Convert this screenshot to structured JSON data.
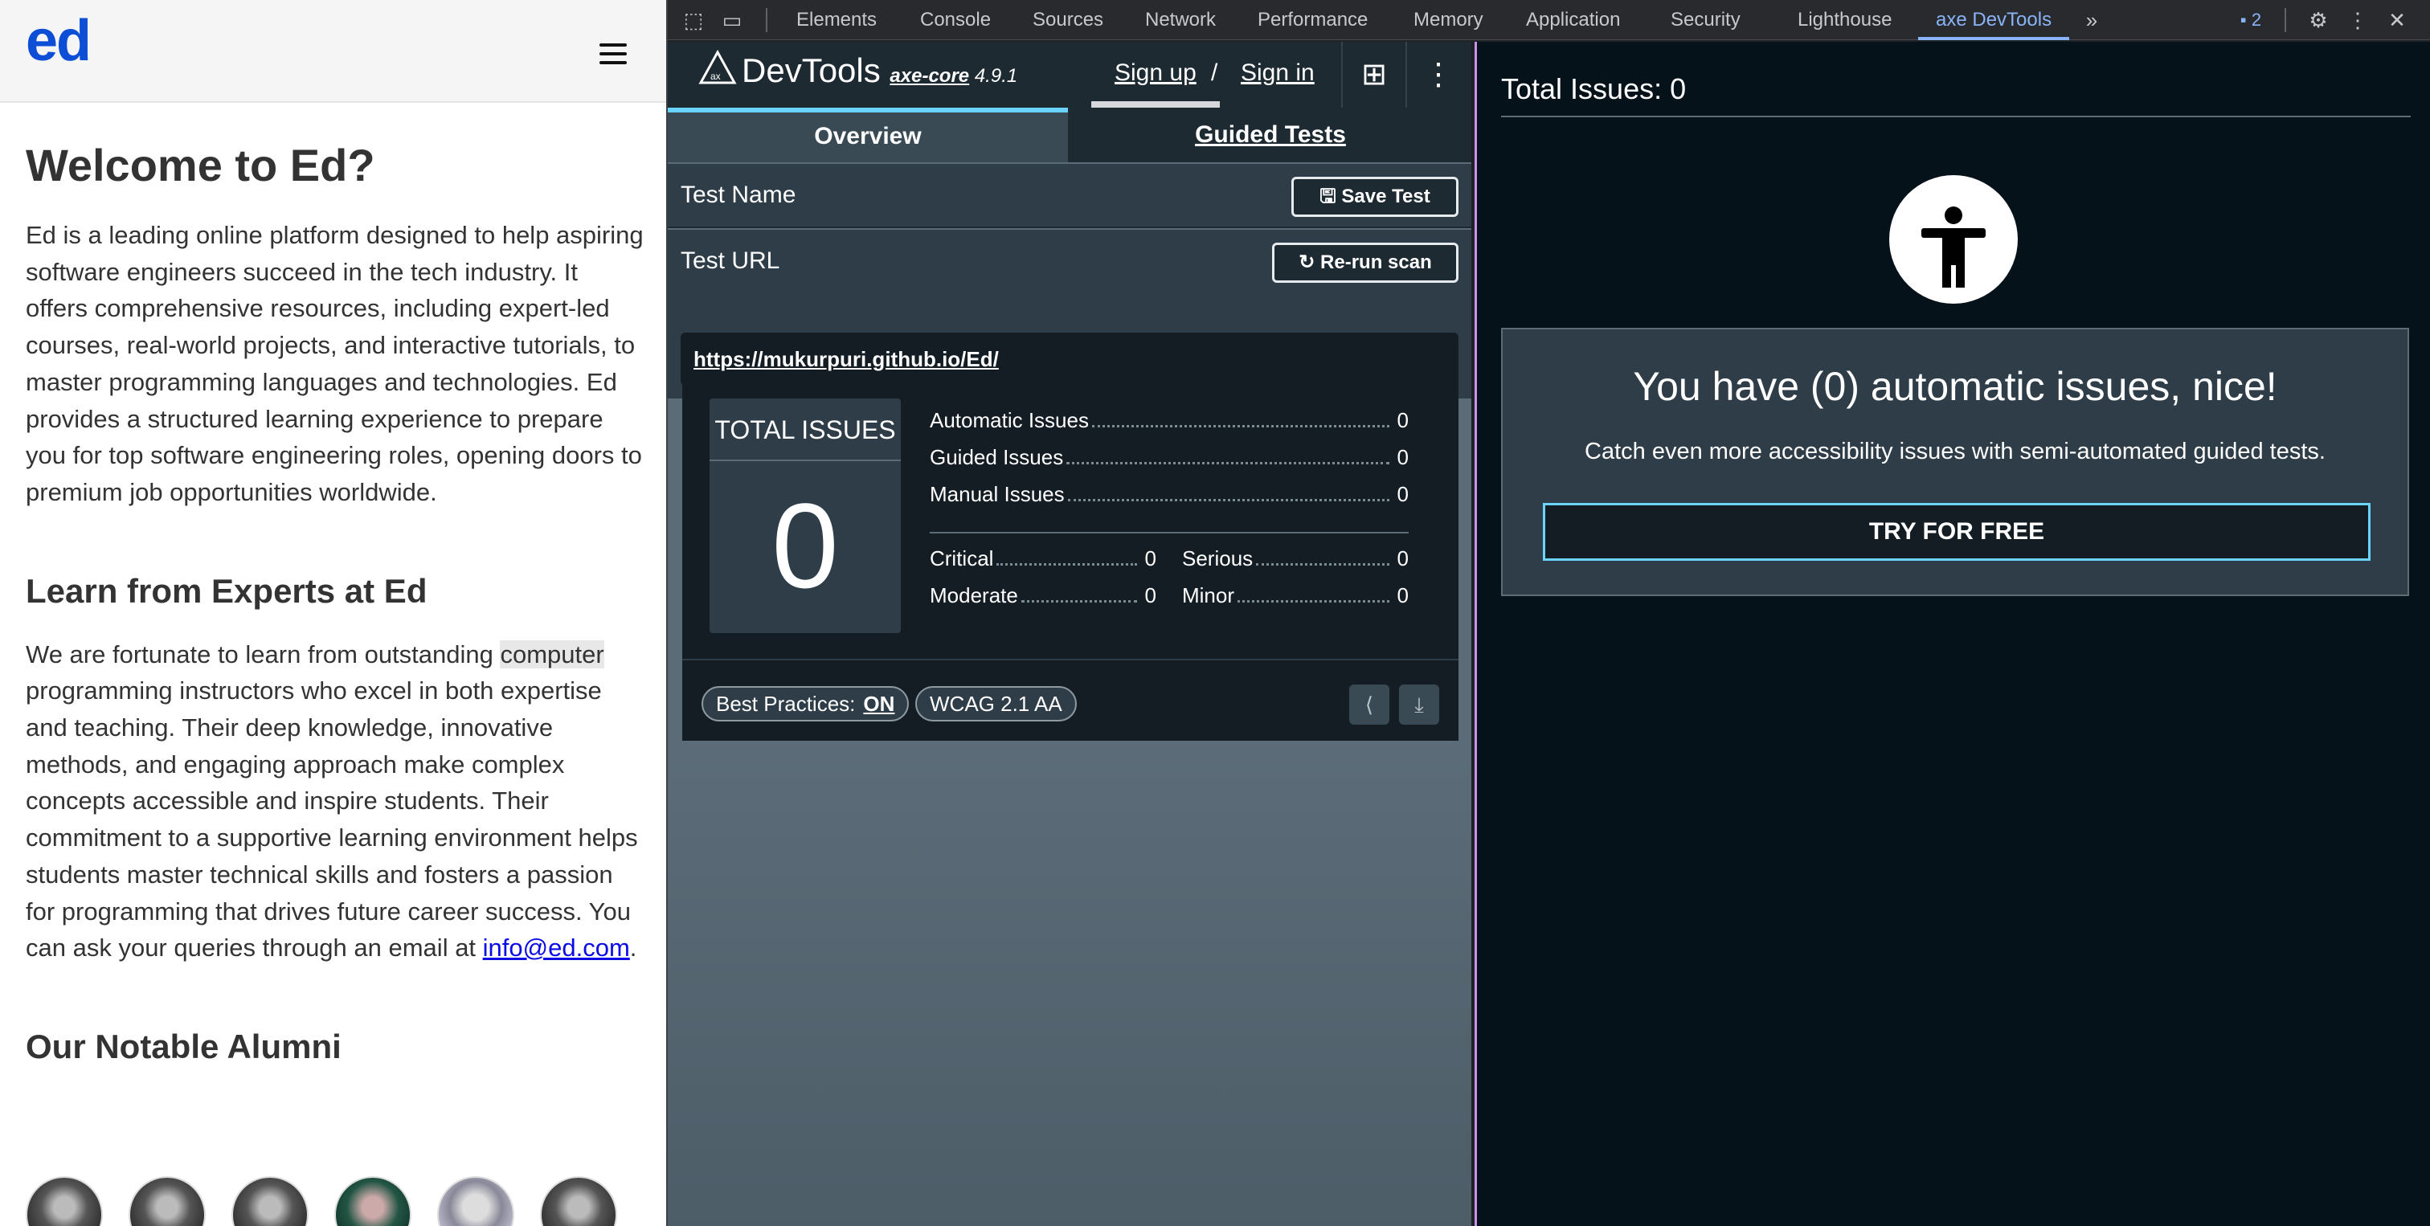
{
  "page": {
    "logo": "ed",
    "heading": "Welcome to Ed?",
    "intro": "Ed is a leading online platform designed to help aspiring software engineers succeed in the tech industry. It offers comprehensive resources, including expert-led courses, real-world projects, and interactive tutorials, to master programming languages and technologies. Ed provides a structured learning experience to prepare you for top software engineering roles, opening doors to premium job opportunities worldwide.",
    "experts_heading": "Learn from Experts at Ed",
    "experts_text_before": "We are fortunate to learn from outstanding ",
    "experts_highlight": "computer",
    "experts_text_after": " programming instructors who excel in both expertise and teaching. Their deep knowledge, innovative methods, and engaging approach make complex concepts accessible and inspire students. Their commitment to a supportive learning environment helps students master technical skills and fosters a passion for programming that drives future career success. You can ask your queries through an email at ",
    "email": "info@ed.com",
    "email_suffix": ".",
    "alumni_heading": "Our Notable Alumni"
  },
  "devtools": {
    "tabs": [
      "Elements",
      "Console",
      "Sources",
      "Network",
      "Performance",
      "Memory",
      "Application",
      "Security",
      "Lighthouse",
      "axe DevTools"
    ],
    "active_tab": "axe DevTools",
    "issues_badge": "2"
  },
  "axe": {
    "brand": "DevTools",
    "core": "axe-core",
    "version": "4.9.1",
    "sign_up": "Sign up",
    "slash": "/",
    "sign_in": "Sign in",
    "tab_overview": "Overview",
    "tab_guided": "Guided Tests",
    "test_name_label": "Test Name",
    "save_test": "Save Test",
    "test_url_label": "Test URL",
    "rerun": "Re-run scan",
    "url": "https://mukurpuri.github.io/Ed/",
    "total_issues_label": "TOTAL ISSUES",
    "total_issues": "0",
    "automatic_label": "Automatic Issues",
    "automatic": "0",
    "guided_label": "Guided Issues",
    "guided": "0",
    "manual_label": "Manual Issues",
    "manual": "0",
    "critical_label": "Critical",
    "critical": "0",
    "serious_label": "Serious",
    "serious": "0",
    "moderate_label": "Moderate",
    "moderate": "0",
    "minor_label": "Minor",
    "minor": "0",
    "best_practices_label": "Best Practices:",
    "best_practices_value": "ON",
    "standard": "WCAG 2.1 AA",
    "right_title": "Total Issues: 0",
    "nice_title": "You have (0) automatic issues, nice!",
    "nice_sub": "Catch even more accessibility issues with semi-automated guided tests.",
    "try_free": "TRY FOR FREE"
  }
}
